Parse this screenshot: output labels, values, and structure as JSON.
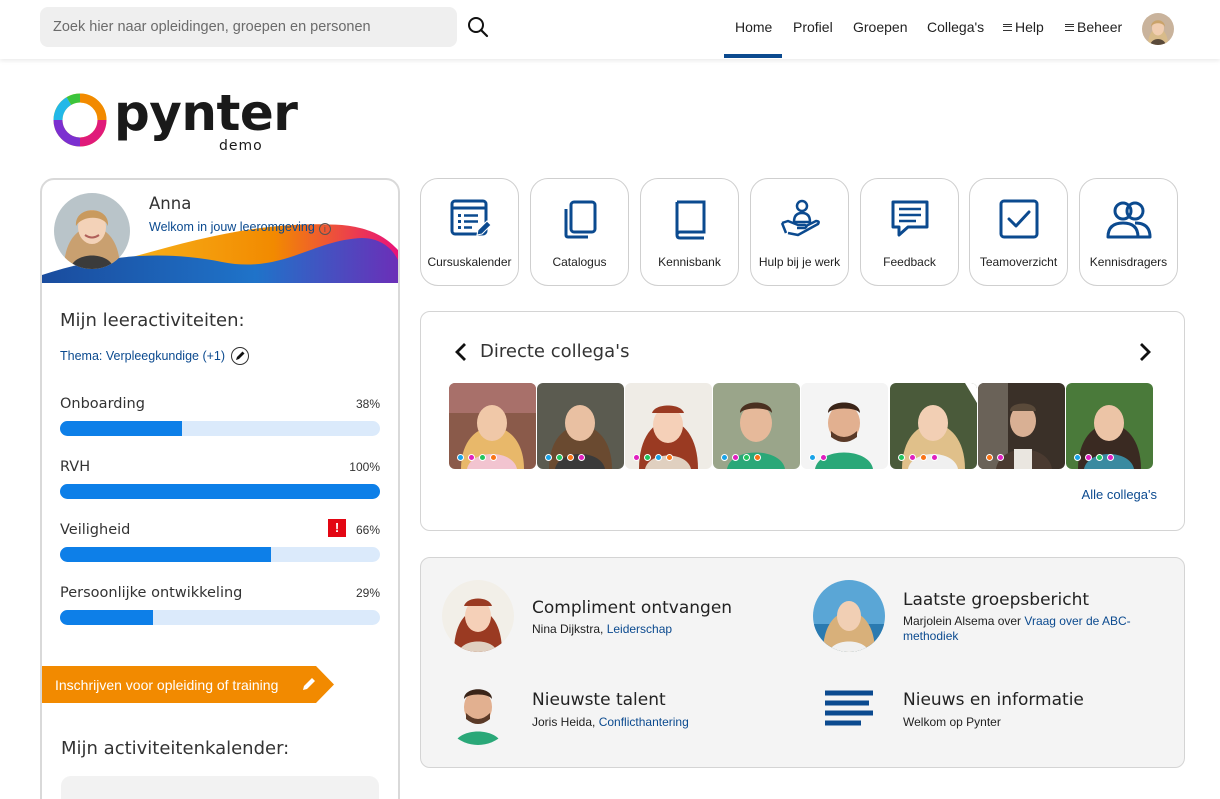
{
  "search": {
    "placeholder": "Zoek hier naar opleidingen, groepen en personen"
  },
  "nav": {
    "home": "Home",
    "profiel": "Profiel",
    "groepen": "Groepen",
    "collegas": "Collega's",
    "help": "Help",
    "beheer": "Beheer"
  },
  "logo": {
    "word": "pynter",
    "sub": "demo"
  },
  "profile": {
    "name": "Anna",
    "welcome": "Welkom in jouw leeromgeving",
    "activities_title": "Mijn leeractiviteiten:",
    "theme": "Thema: Verpleegkundige (+1)",
    "activities": [
      {
        "label": "Onboarding",
        "percent_text": "38%",
        "value": 0.38,
        "alert": false
      },
      {
        "label": "RVH",
        "percent_text": "100%",
        "value": 1.0,
        "alert": false
      },
      {
        "label": "Veiligheid",
        "percent_text": "66%",
        "value": 0.66,
        "alert": true
      },
      {
        "label": "Persoonlijke ontwikkeling",
        "percent_text": "29%",
        "value": 0.29,
        "alert": false
      }
    ],
    "enroll": "Inschrijven voor opleiding of training",
    "calendar_title": "Mijn activiteitenkalender:"
  },
  "tiles": [
    {
      "label": "Cursuskalender",
      "icon": "calendar-list-icon"
    },
    {
      "label": "Catalogus",
      "icon": "copy-icon"
    },
    {
      "label": "Kennisbank",
      "icon": "book-icon"
    },
    {
      "label": "Hulp bij je werk",
      "icon": "helping-hand-icon"
    },
    {
      "label": "Feedback",
      "icon": "chat-bubble-icon"
    },
    {
      "label": "Teamoverzicht",
      "icon": "checkbox-icon"
    },
    {
      "label": "Kennisdragers",
      "icon": "users-icon"
    }
  ],
  "colleagues": {
    "title": "Directe collega's",
    "all_link": "Alle collega's",
    "people": [
      {
        "dots": [
          "#1aa3e8",
          "#e020c0",
          "#22c55e",
          "#f97316"
        ]
      },
      {
        "dots": [
          "#1aa3e8",
          "#22c55e",
          "#f97316",
          "#e020c0"
        ]
      },
      {
        "dots": [
          "#e020c0",
          "#22c55e",
          "#1aa3e8",
          "#f97316"
        ]
      },
      {
        "dots": [
          "#1aa3e8",
          "#e020c0",
          "#22c55e",
          "#f97316"
        ]
      },
      {
        "dots": [
          "#1aa3e8",
          "#e020c0"
        ]
      },
      {
        "dots": [
          "#22c55e",
          "#e020c0",
          "#f97316",
          "#e020c0"
        ]
      },
      {
        "dots": [
          "#f97316",
          "#e020c0"
        ]
      },
      {
        "dots": [
          "#1aa3e8",
          "#e020c0",
          "#22c55e",
          "#e020c0"
        ]
      }
    ]
  },
  "info": {
    "compliment": {
      "title": "Compliment ontvangen",
      "person": "Nina Dijkstra, ",
      "link": "Leiderschap"
    },
    "groepsbericht": {
      "title": "Laatste groepsbericht",
      "person": "Marjolein Alsema over ",
      "link": "Vraag over de ABC-methodiek"
    },
    "talent": {
      "title": "Nieuwste talent",
      "person": "Joris Heida, ",
      "link": "Conflicthantering"
    },
    "nieuws": {
      "title": "Nieuws en informatie",
      "text": "Welkom op Pynter"
    }
  },
  "colors": {
    "brand_blue": "#0b4a8f",
    "bar_fill": "#0d7fe8",
    "bar_track": "#dbeafb",
    "enroll_orange": "#f28a00",
    "alert_red": "#e30613"
  }
}
